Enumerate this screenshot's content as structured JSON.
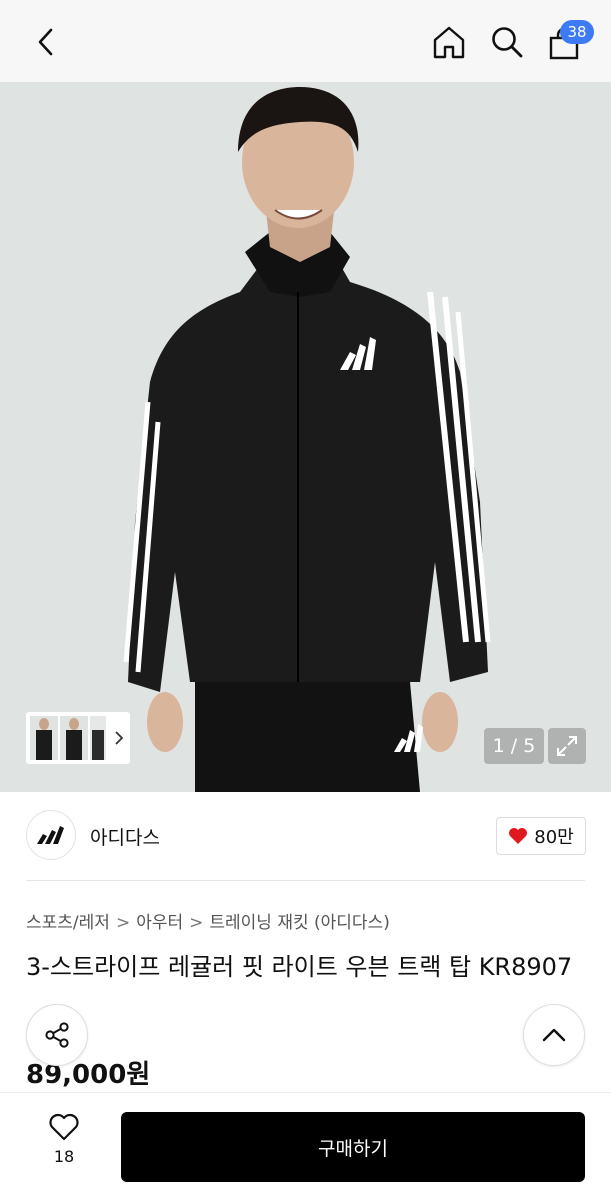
{
  "header": {
    "back_icon": "chevron-left-icon",
    "home_icon": "home-icon",
    "search_icon": "search-icon",
    "cart_icon": "shopping-bag-icon",
    "cart_count": "38"
  },
  "gallery": {
    "counter": "1 / 5",
    "expand_icon": "expand-icon",
    "thumbnail_arrow_icon": "chevron-right-icon"
  },
  "brand": {
    "name": "아디다스",
    "like_count": "80만",
    "heart_color": "#e0191e"
  },
  "breadcrumb": [
    "스포츠/레저",
    "아우터",
    "트레이닝 재킷 (아디다스)"
  ],
  "product": {
    "title": "3-스트라이프 레귤러 핏 라이트 우븐 트랙 탑 KR8907",
    "price": "89,000원"
  },
  "floating": {
    "share_icon": "share-icon",
    "scroll_top_icon": "chevron-up-icon"
  },
  "bottom_bar": {
    "wish_count": "18",
    "buy_label": "구매하기"
  },
  "colors": {
    "badge": "#3d7bf5",
    "buy_button": "#000000"
  }
}
